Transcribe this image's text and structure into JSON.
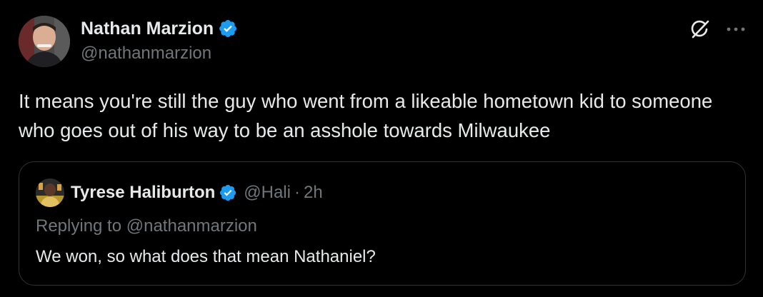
{
  "tweet": {
    "author": {
      "name": "Nathan Marzion",
      "handle": "@nathanmarzion",
      "verified": true
    },
    "text": "It means you're still the guy who went from a likeable hometown kid to someone who goes out of his way to be an asshole towards Milwaukee",
    "actions": {
      "grok_icon": "grok-icon",
      "more_icon": "more-icon"
    }
  },
  "quote": {
    "author": {
      "name": "Tyrese Haliburton",
      "handle": "@Hali",
      "verified": true
    },
    "separator": "·",
    "time": "2h",
    "replying_to": "Replying to @nathanmarzion",
    "text": "We won, so what does that mean Nathaniel?"
  },
  "colors": {
    "background": "#000000",
    "primary_text": "#e7e9ea",
    "secondary_text": "#71767b",
    "verified_badge": "#1d9bf0",
    "border": "#2f3336"
  }
}
